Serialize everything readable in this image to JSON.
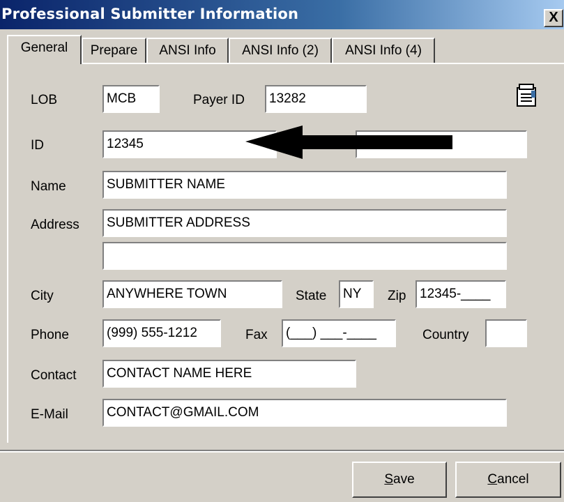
{
  "window": {
    "title": "Professional Submitter Information",
    "close_label": "X"
  },
  "tabs": [
    {
      "label": "General",
      "active": true
    },
    {
      "label": "Prepare",
      "active": false
    },
    {
      "label": "ANSI Info",
      "active": false
    },
    {
      "label": "ANSI Info (2)",
      "active": false
    },
    {
      "label": "ANSI Info (4)",
      "active": false
    }
  ],
  "form": {
    "lob": {
      "label": "LOB",
      "value": "MCB"
    },
    "payer_id": {
      "label": "Payer ID",
      "value": "13282"
    },
    "id": {
      "label": "ID",
      "value": "12345"
    },
    "redacted_field": {
      "value": ""
    },
    "name": {
      "label": "Name",
      "value": "SUBMITTER NAME"
    },
    "address": {
      "label": "Address",
      "line1": "SUBMITTER ADDRESS",
      "line2": ""
    },
    "city": {
      "label": "City",
      "value": "ANYWHERE TOWN"
    },
    "state": {
      "label": "State",
      "value": "NY"
    },
    "zip": {
      "label": "Zip",
      "value": "12345-____"
    },
    "phone": {
      "label": "Phone",
      "value": "(999) 555-1212"
    },
    "fax": {
      "label": "Fax",
      "value": "(___) ___-____"
    },
    "country": {
      "label": "Country",
      "value": ""
    },
    "contact": {
      "label": "Contact",
      "value": "CONTACT NAME HERE"
    },
    "email": {
      "label": "E-Mail",
      "value": "CONTACT@GMAIL.COM"
    }
  },
  "buttons": {
    "save": {
      "mnemonic": "S",
      "rest": "ave"
    },
    "cancel": {
      "mnemonic": "C",
      "rest": "ancel"
    }
  },
  "icons": {
    "notes": "notepad-icon",
    "arrow": "arrow-left-icon",
    "colors": {
      "titlebar": "#0a246a",
      "face": "#d4d0c8"
    }
  }
}
